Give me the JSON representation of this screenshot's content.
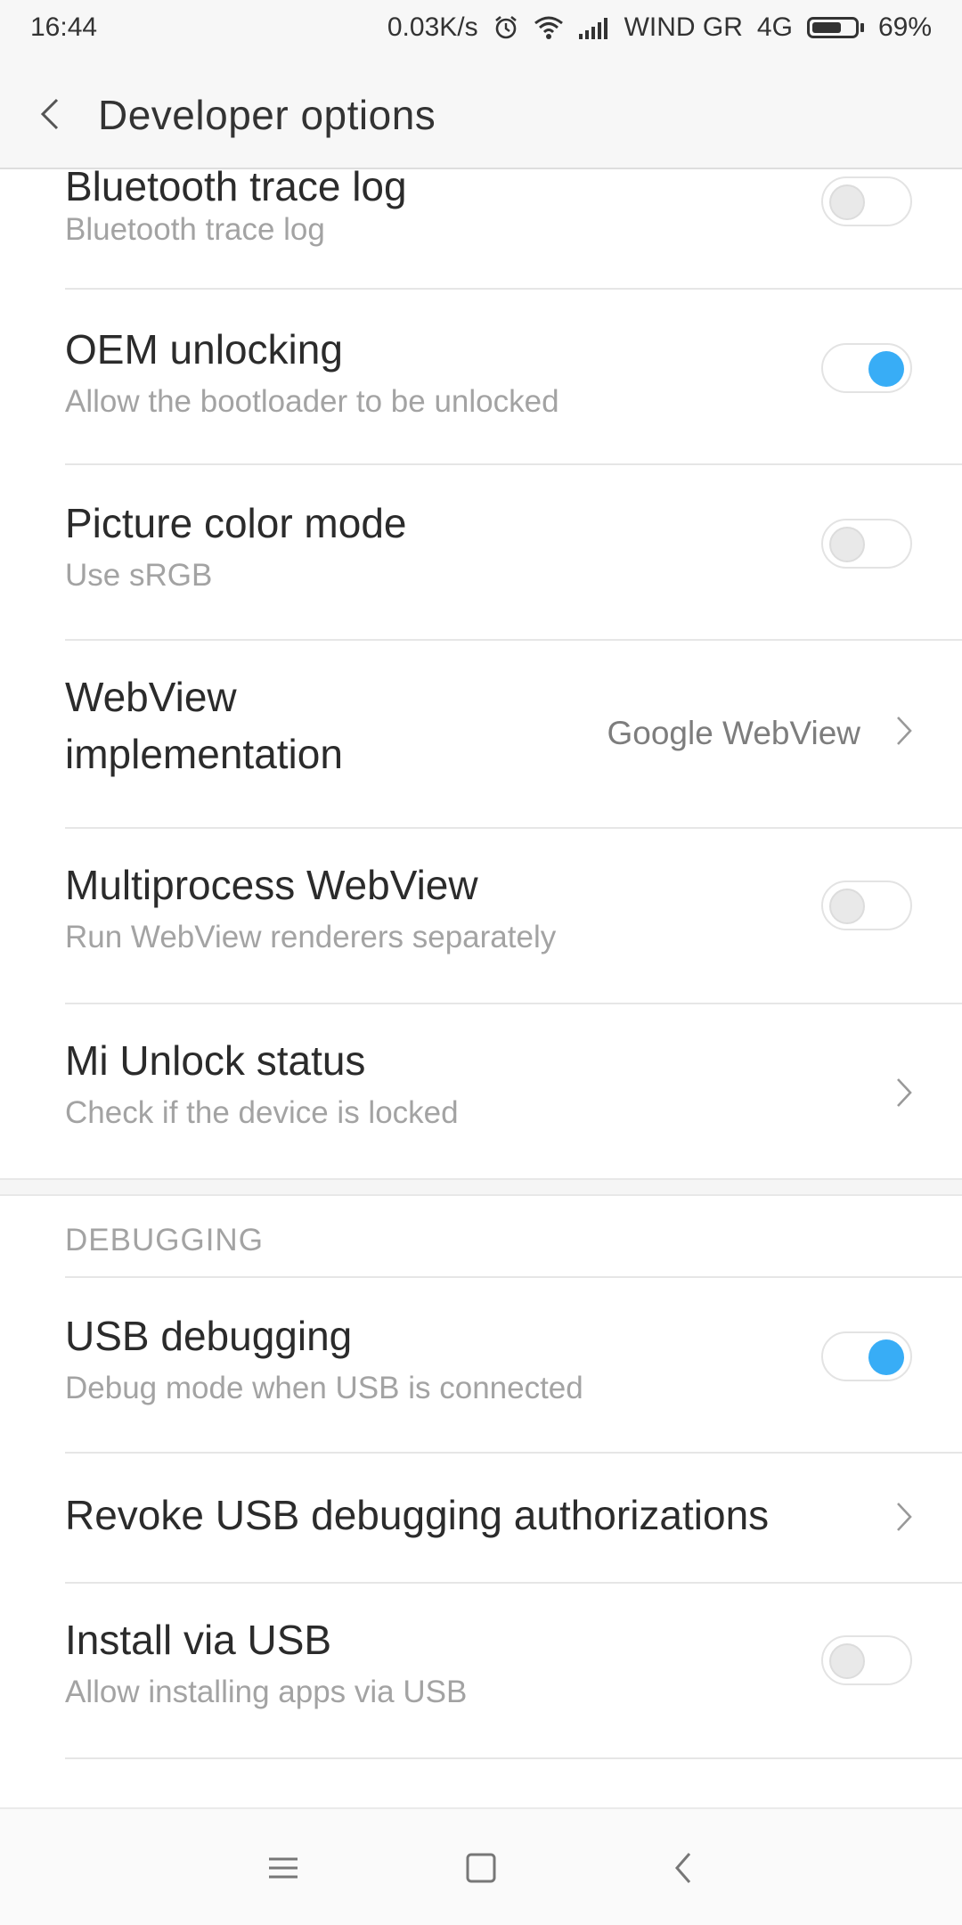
{
  "status_bar": {
    "time": "16:44",
    "speed": "0.03K/s",
    "carrier": "WIND  GR",
    "network": "4G",
    "battery_percent": "69%",
    "battery_level": 0.69,
    "icons": [
      "alarm-icon",
      "wifi-icon",
      "signal-icon",
      "battery-icon"
    ]
  },
  "header": {
    "title": "Developer  options"
  },
  "rows": {
    "bluetooth_trace": {
      "title": "Bluetooth trace log",
      "subtitle": "Bluetooth trace log",
      "enabled": false
    },
    "oem_unlocking": {
      "title": "OEM unlocking",
      "subtitle": "Allow the bootloader to be unlocked",
      "enabled": true
    },
    "picture_color": {
      "title": "Picture color mode",
      "subtitle": "Use sRGB",
      "enabled": false
    },
    "webview_impl": {
      "title_line1": "WebView",
      "title_line2": "implementation",
      "value": "Google WebView"
    },
    "multiprocess_webview": {
      "title": "Multiprocess WebView",
      "subtitle": "Run WebView renderers separately",
      "enabled": false
    },
    "mi_unlock": {
      "title": "Mi Unlock status",
      "subtitle": "Check if the device is locked"
    },
    "usb_debugging": {
      "title": "USB debugging",
      "subtitle": "Debug mode when USB is connected",
      "enabled": true
    },
    "revoke_usb": {
      "title": "Revoke USB debugging authorizations"
    },
    "install_usb": {
      "title": "Install via USB",
      "subtitle": "Allow installing apps via USB",
      "enabled": false
    }
  },
  "sections": {
    "debugging": "DEBUGGING"
  },
  "colors": {
    "accent": "#38adf6",
    "subtitle": "#a3a3a3",
    "divider": "#e6e6e6"
  },
  "nav_bar": {
    "icons": [
      "menu-icon",
      "home-icon",
      "back-icon"
    ]
  }
}
